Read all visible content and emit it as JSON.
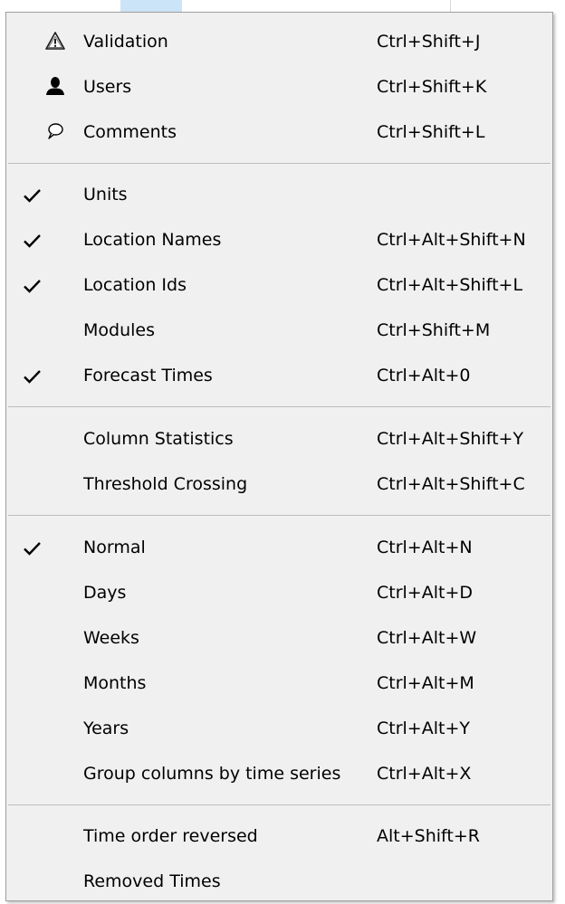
{
  "menu": {
    "items": [
      {
        "label": "Validation",
        "shortcut": "Ctrl+Shift+J",
        "icon": "warning-icon",
        "checked": false
      },
      {
        "label": "Users",
        "shortcut": "Ctrl+Shift+K",
        "icon": "user-icon",
        "checked": false
      },
      {
        "label": "Comments",
        "shortcut": "Ctrl+Shift+L",
        "icon": "comment-icon",
        "checked": false
      },
      {
        "label": "Units",
        "shortcut": "",
        "checked": true
      },
      {
        "label": "Location Names",
        "shortcut": "Ctrl+Alt+Shift+N",
        "checked": true
      },
      {
        "label": "Location Ids",
        "shortcut": "Ctrl+Alt+Shift+L",
        "checked": true
      },
      {
        "label": "Modules",
        "shortcut": "Ctrl+Shift+M",
        "checked": false
      },
      {
        "label": "Forecast Times",
        "shortcut": "Ctrl+Alt+0",
        "checked": true
      },
      {
        "label": "Column Statistics",
        "shortcut": "Ctrl+Alt+Shift+Y",
        "checked": false
      },
      {
        "label": "Threshold Crossing",
        "shortcut": "Ctrl+Alt+Shift+C",
        "checked": false
      },
      {
        "label": "Normal",
        "shortcut": "Ctrl+Alt+N",
        "checked": true
      },
      {
        "label": "Days",
        "shortcut": "Ctrl+Alt+D",
        "checked": false
      },
      {
        "label": "Weeks",
        "shortcut": "Ctrl+Alt+W",
        "checked": false
      },
      {
        "label": "Months",
        "shortcut": "Ctrl+Alt+M",
        "checked": false
      },
      {
        "label": "Years",
        "shortcut": "Ctrl+Alt+Y",
        "checked": false
      },
      {
        "label": "Group columns by time series",
        "shortcut": "Ctrl+Alt+X",
        "checked": false
      },
      {
        "label": "Time order reversed",
        "shortcut": "Alt+Shift+R",
        "checked": false
      },
      {
        "label": "Removed Times",
        "shortcut": "",
        "checked": false
      }
    ]
  },
  "colors": {
    "menu_background": "#f0f0f0",
    "separator": "#bdbdbd",
    "border": "#a0a0a0",
    "highlight": "#cce4f7"
  }
}
